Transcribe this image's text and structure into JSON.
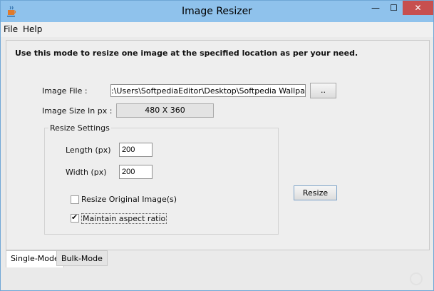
{
  "window": {
    "title": "Image Resizer",
    "controls": {
      "minimize": "—",
      "maximize": "☐",
      "close": "✕"
    }
  },
  "menu": [
    "File",
    "Help"
  ],
  "single_mode": {
    "intro": "Use this mode to resize one image at the specified location as per your need.",
    "image_file_label": "Image File :",
    "image_file_path": ":\\Users\\SoftpediaEditor\\Desktop\\Softpedia Wallpaper.jpg",
    "browse_label": "..",
    "image_size_label": "Image Size In px :",
    "image_size_value": "480 X 360",
    "resize_settings": {
      "title": "Resize Settings",
      "length_label": "Length (px)",
      "length_value": "200",
      "width_label": "Width (px)",
      "width_value": "200"
    },
    "options": [
      {
        "label": "Resize Original Image(s)",
        "checked": false
      },
      {
        "label": "Maintain aspect ratio",
        "checked": true
      }
    ],
    "resize_button": "Resize"
  },
  "tabs": [
    {
      "label": "Single-Mode",
      "active": true
    },
    {
      "label": "Bulk-Mode",
      "active": false
    }
  ]
}
